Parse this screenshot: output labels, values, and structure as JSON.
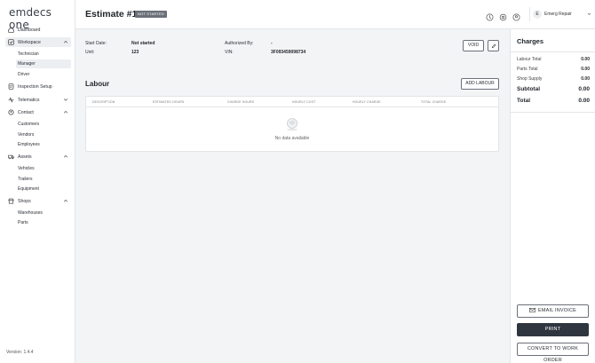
{
  "app": {
    "logo": "emdecs one",
    "version": "Version: 1.4.4"
  },
  "sidebar": {
    "items": [
      {
        "label": "Dashboard"
      },
      {
        "label": "Workspace"
      },
      {
        "label": "Technician"
      },
      {
        "label": "Manager"
      },
      {
        "label": "Driver"
      },
      {
        "label": "Inspection Setup"
      },
      {
        "label": "Telematics"
      },
      {
        "label": "Contact"
      },
      {
        "label": "Customers"
      },
      {
        "label": "Vendors"
      },
      {
        "label": "Employees"
      },
      {
        "label": "Assets"
      },
      {
        "label": "Vehicles"
      },
      {
        "label": "Trailers"
      },
      {
        "label": "Equipment"
      },
      {
        "label": "Shops"
      },
      {
        "label": "Warehouses"
      },
      {
        "label": "Parts"
      }
    ]
  },
  "header": {
    "title": "Estimate #1",
    "status": "NOT STARTED",
    "user_initial": "E",
    "user_name": "Emerg Repair"
  },
  "details": {
    "start_date_label": "Start Date:",
    "start_date_value": "Not started",
    "unit_label": "Unit:",
    "unit_value": "123",
    "authorized_by_label": "Authorized By:",
    "authorized_by_value": "-",
    "vin_label": "VIN:",
    "vin_value": "3F093459098734",
    "void_label": "VOID"
  },
  "labour": {
    "title": "Labour",
    "add_label": "ADD LABOUR",
    "columns": [
      "DESCRIPTION",
      "ESTIMATED HOURS",
      "CHARGE HOURS",
      "HOURLY COST",
      "HOURLY CHARGE",
      "TOTAL CHARGE"
    ],
    "empty_text": "No data available"
  },
  "charges": {
    "title": "Charges",
    "rows": [
      {
        "label": "Labour Total",
        "value": "0.00"
      },
      {
        "label": "Parts Total",
        "value": "0.00"
      },
      {
        "label": "Shop Supply",
        "value": "0.00"
      },
      {
        "label": "Subtotal",
        "value": "0.00"
      },
      {
        "label": "Total",
        "value": "0.00"
      }
    ],
    "email_label": "EMAIL INVOICE",
    "print_label": "PRINT",
    "convert_label": "CONVERT TO WORK ORDER"
  },
  "colors": {
    "accent_dark": "#2f3640",
    "badge_bg": "#6b7079",
    "background": "#f3f4f6"
  }
}
